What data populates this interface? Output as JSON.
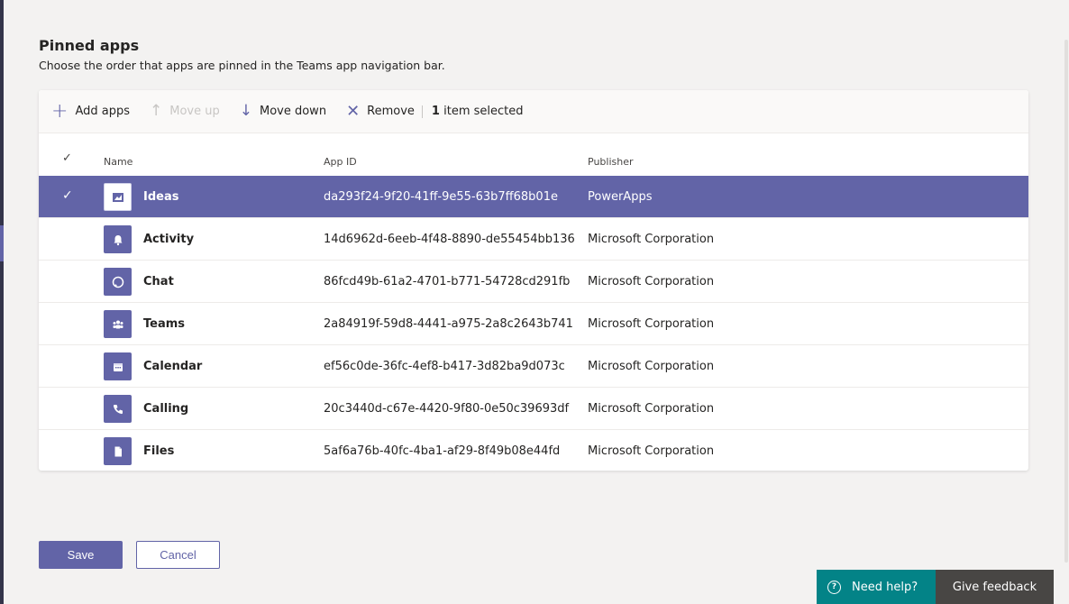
{
  "header": {
    "title": "Pinned apps",
    "description": "Choose the order that apps are pinned in the Teams app navigation bar."
  },
  "toolbar": {
    "add_label": "Add apps",
    "move_up_label": "Move up",
    "move_down_label": "Move down",
    "remove_label": "Remove",
    "selected_count": "1",
    "selected_suffix": "item selected"
  },
  "table": {
    "columns": {
      "name": "Name",
      "app_id": "App ID",
      "publisher": "Publisher"
    },
    "rows": [
      {
        "name": "Ideas",
        "app_id": "da293f24-9f20-41ff-9e55-63b7ff68b01e",
        "publisher": "PowerApps",
        "icon": "ideas-icon",
        "selected": true
      },
      {
        "name": "Activity",
        "app_id": "14d6962d-6eeb-4f48-8890-de55454bb136",
        "publisher": "Microsoft Corporation",
        "icon": "bell-icon",
        "selected": false
      },
      {
        "name": "Chat",
        "app_id": "86fcd49b-61a2-4701-b771-54728cd291fb",
        "publisher": "Microsoft Corporation",
        "icon": "chat-icon",
        "selected": false
      },
      {
        "name": "Teams",
        "app_id": "2a84919f-59d8-4441-a975-2a8c2643b741",
        "publisher": "Microsoft Corporation",
        "icon": "teams-icon",
        "selected": false
      },
      {
        "name": "Calendar",
        "app_id": "ef56c0de-36fc-4ef8-b417-3d82ba9d073c",
        "publisher": "Microsoft Corporation",
        "icon": "calendar-icon",
        "selected": false
      },
      {
        "name": "Calling",
        "app_id": "20c3440d-c67e-4420-9f80-0e50c39693df",
        "publisher": "Microsoft Corporation",
        "icon": "phone-icon",
        "selected": false
      },
      {
        "name": "Files",
        "app_id": "5af6a76b-40fc-4ba1-af29-8f49b08e44fd",
        "publisher": "Microsoft Corporation",
        "icon": "file-icon",
        "selected": false
      }
    ]
  },
  "actions": {
    "save_label": "Save",
    "cancel_label": "Cancel"
  },
  "footer": {
    "help_label": "Need help?",
    "feedback_label": "Give feedback"
  },
  "colors": {
    "accent": "#6264a7",
    "help_bg": "#038387",
    "feedback_bg": "#484644",
    "page_bg": "#f3f2f1"
  }
}
